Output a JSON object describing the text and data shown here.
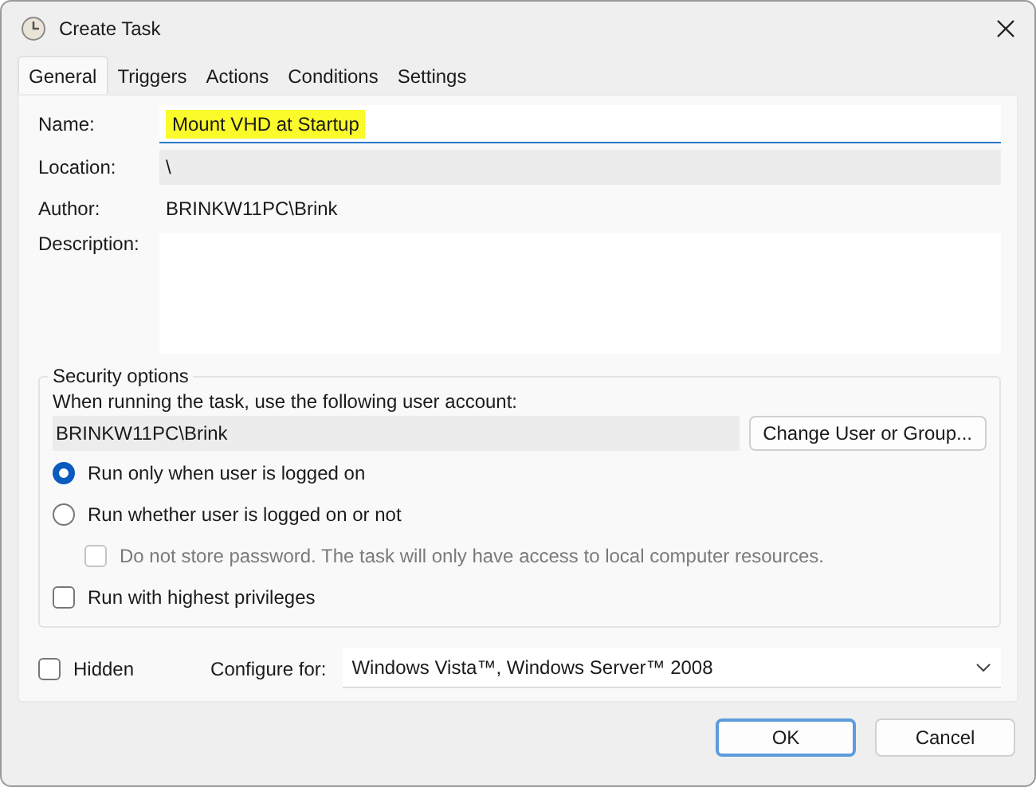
{
  "window": {
    "title": "Create Task"
  },
  "tabs": [
    {
      "label": "General",
      "selected": true
    },
    {
      "label": "Triggers",
      "selected": false
    },
    {
      "label": "Actions",
      "selected": false
    },
    {
      "label": "Conditions",
      "selected": false
    },
    {
      "label": "Settings",
      "selected": false
    }
  ],
  "fields": {
    "name_label": "Name:",
    "name_value": "Mount VHD at Startup",
    "name_highlighted": true,
    "location_label": "Location:",
    "location_value": "\\",
    "author_label": "Author:",
    "author_value": "BRINKW11PC\\Brink",
    "description_label": "Description:"
  },
  "security": {
    "title": "Security options",
    "prompt": "When running the task, use the following user account:",
    "account": "BRINKW11PC\\Brink",
    "change_button": "Change User or Group...",
    "options": [
      {
        "kind": "radio",
        "label": "Run only when user is logged on",
        "selected": true,
        "disabled": false
      },
      {
        "kind": "radio",
        "label": "Run whether user is logged on or not",
        "selected": false,
        "disabled": false,
        "children": [
          {
            "kind": "checkbox",
            "label": "Do not store password.  The task will only have access to local computer resources.",
            "checked": false,
            "disabled": true
          }
        ]
      },
      {
        "kind": "checkbox",
        "label": "Run with highest privileges",
        "checked": false,
        "disabled": false
      }
    ]
  },
  "hidden": {
    "label": "Hidden",
    "checked": false
  },
  "configure": {
    "label": "Configure for:",
    "value": "Windows Vista™, Windows Server™ 2008"
  },
  "buttons": [
    {
      "label": "OK",
      "default": true
    },
    {
      "label": "Cancel",
      "default": false
    }
  ]
}
